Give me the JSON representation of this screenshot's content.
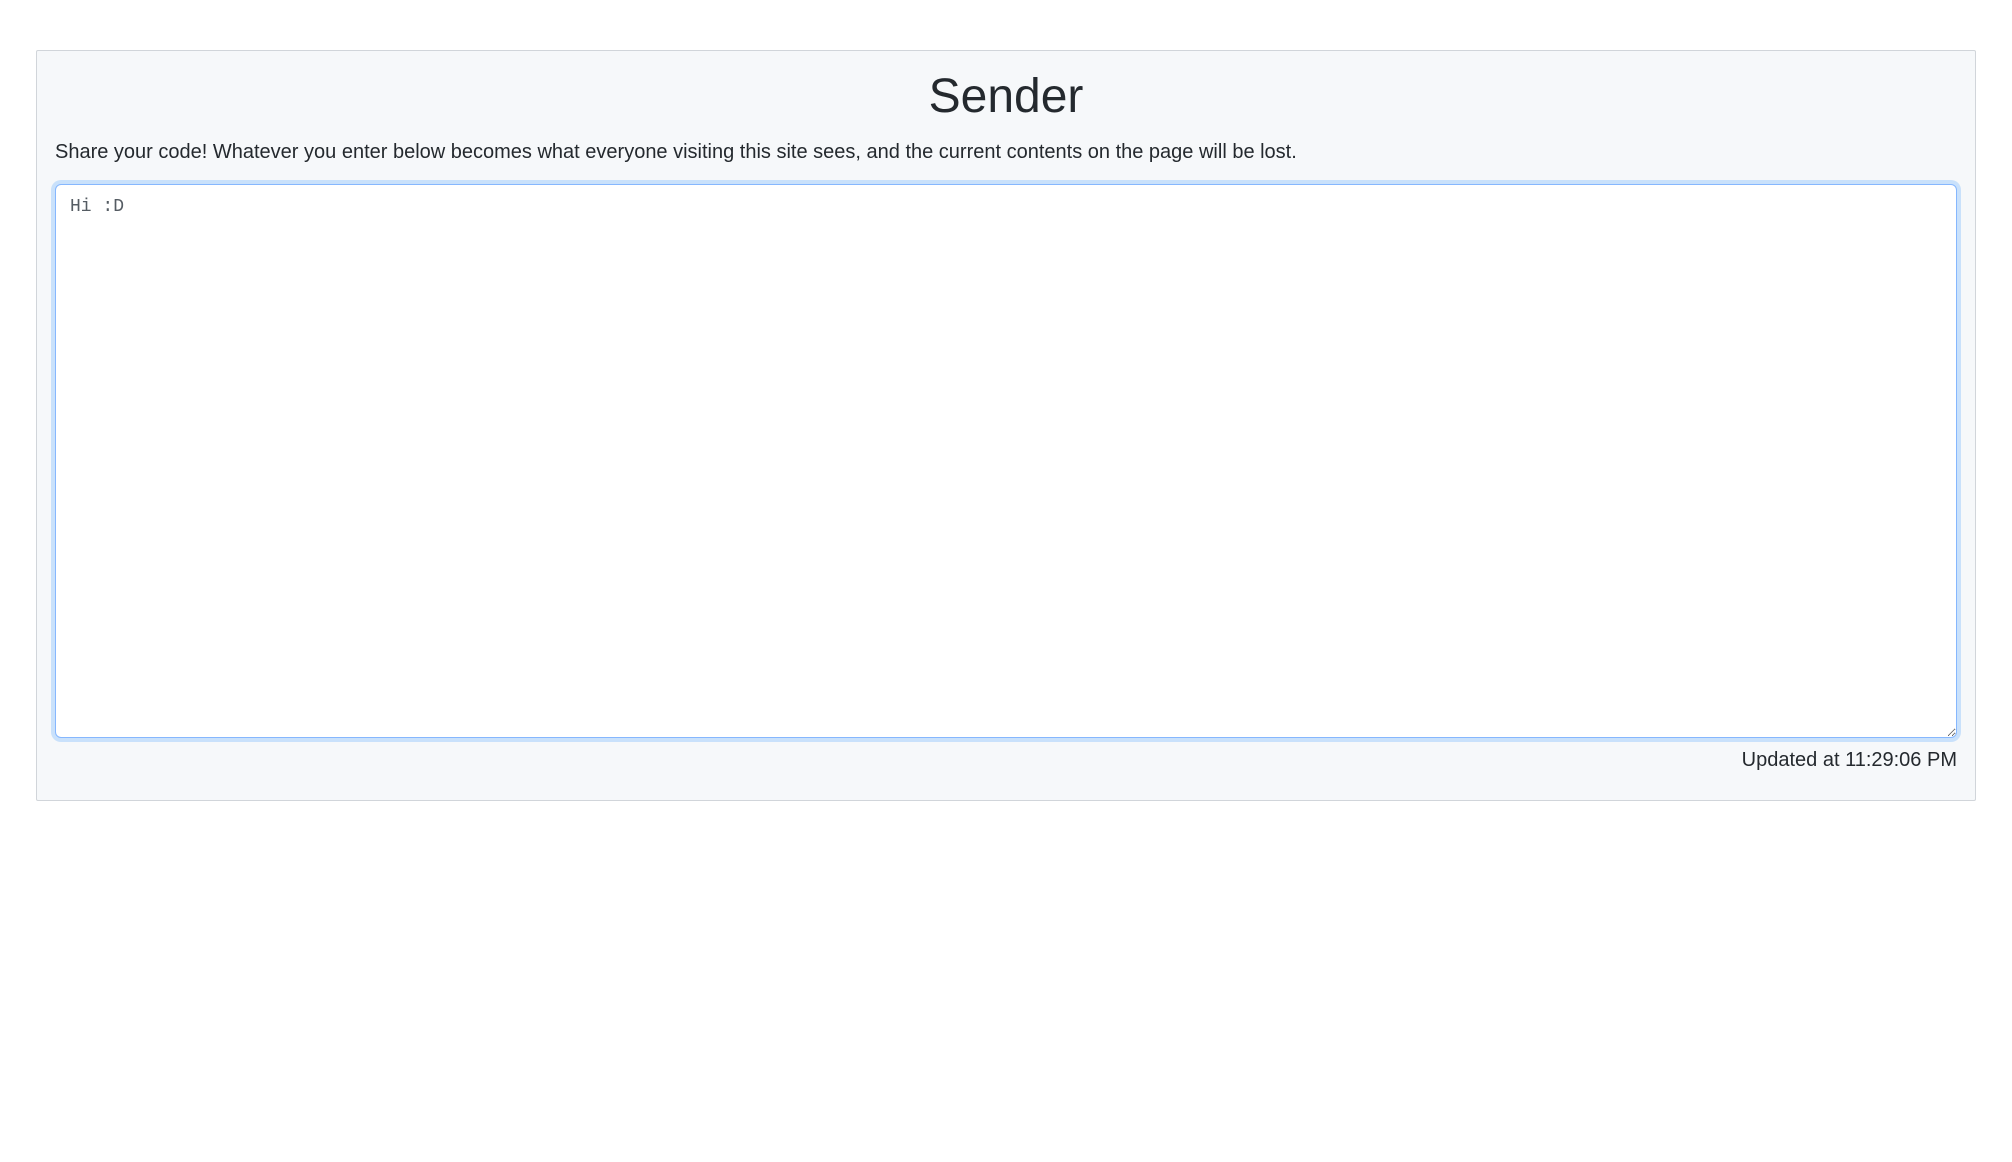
{
  "header": {
    "title": "Sender",
    "description": "Share your code! Whatever you enter below becomes what everyone visiting this site sees, and the current contents on the page will be lost."
  },
  "editor": {
    "value": "Hi :D"
  },
  "footer": {
    "updated_text": "Updated at 11:29:06 PM"
  }
}
